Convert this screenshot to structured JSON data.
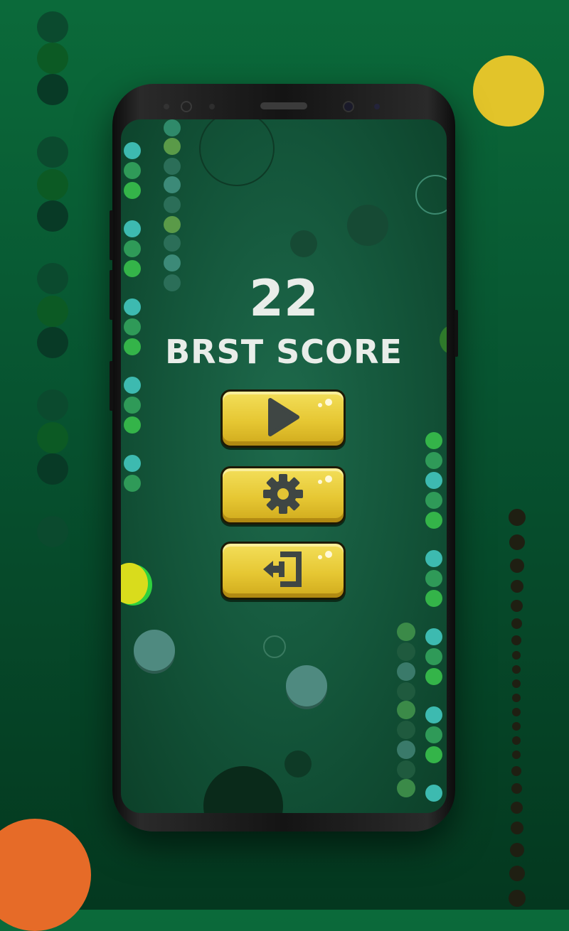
{
  "game": {
    "score": "22",
    "best_score_label": "BRST SCORE"
  },
  "buttons": [
    {
      "name": "play",
      "icon": "play-icon"
    },
    {
      "name": "settings",
      "icon": "gear-icon"
    },
    {
      "name": "exit",
      "icon": "exit-icon"
    }
  ],
  "colors": {
    "background": "#075330",
    "button_yellow": "#e6c733",
    "icon_gray": "#3f4644",
    "accent_yellow": "#e2c42a",
    "accent_orange": "#e66b28",
    "dot_cyan": "#3dbab0",
    "dot_green": "#34b449"
  }
}
